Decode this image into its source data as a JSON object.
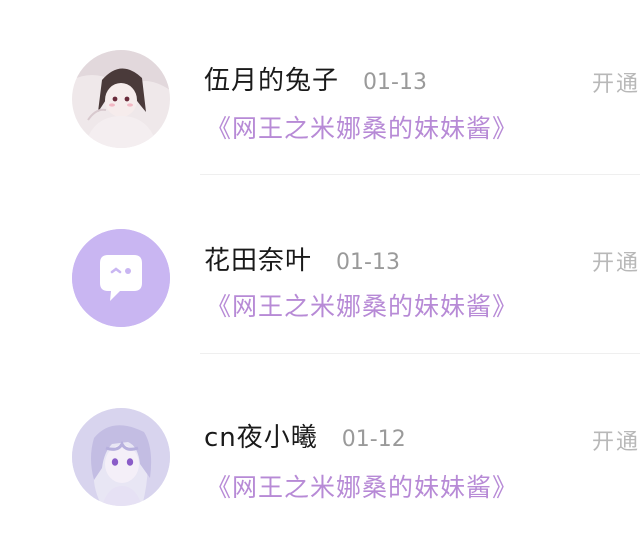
{
  "rows": [
    {
      "username": "伍月的兔子",
      "date": "01-13",
      "book": "《网王之米娜桑的妹妹酱》",
      "action": "开通",
      "avatar": "girl-illustration-avatar"
    },
    {
      "username": "花田奈叶",
      "date": "01-13",
      "book": "《网王之米娜桑的妹妹酱》",
      "action": "开通",
      "avatar": "default-chat-bubble-avatar"
    },
    {
      "username": "cn夜小曦",
      "date": "01-12",
      "book": "《网王之米娜桑的妹妹酱》",
      "action": "开通",
      "avatar": "anime-girl-avatar"
    }
  ],
  "colors": {
    "book_title": "#b78ad6",
    "default_avatar_bg": "#c9b6f2",
    "username": "#1a1a1a",
    "date": "#9a9a9a",
    "action": "#b8b8b8"
  }
}
